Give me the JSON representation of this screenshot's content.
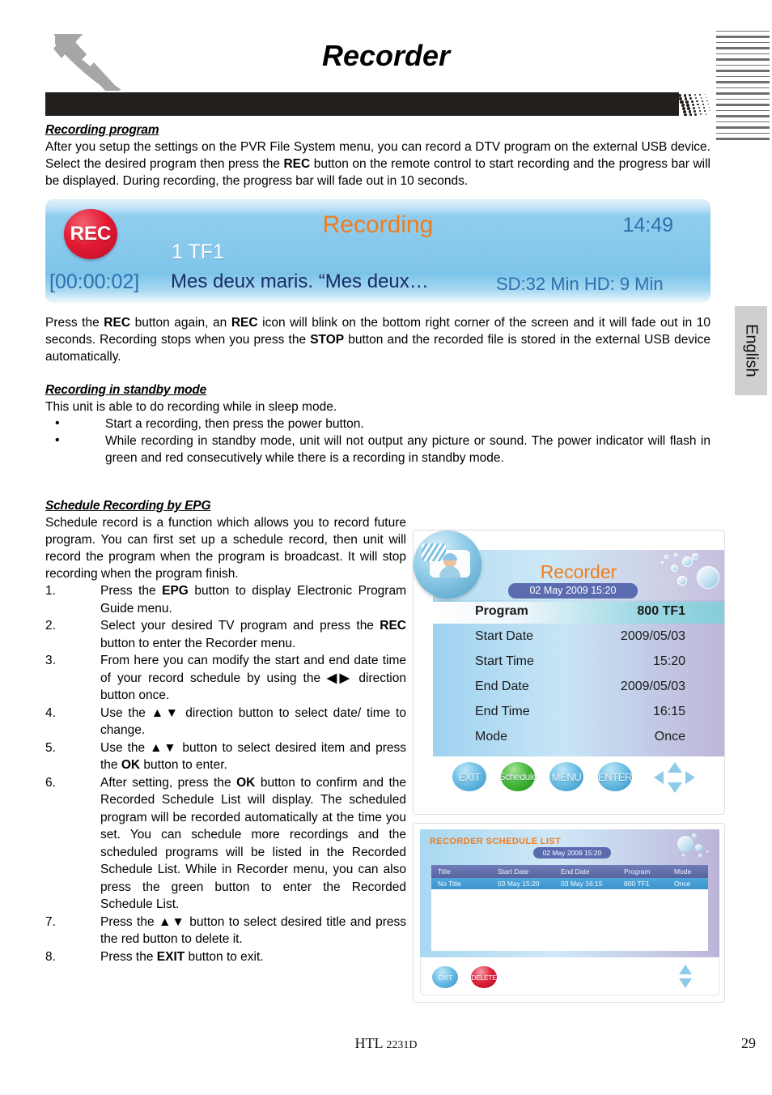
{
  "header": {
    "title": "Recorder",
    "logo": "xoro-x-logo"
  },
  "side_tab": {
    "label": "English"
  },
  "sections": {
    "recording_program": {
      "heading": "Recording program",
      "paragraph_pre": "After you setup  the settings on  the PVR File System menu, you can  record a DTV program on  the external USB device. Select  the desired program  then press  the ",
      "bold1": "REC",
      "paragraph_post": " button on  the remote control to start recording and the progress bar will be displayed. During recording, the progress bar will fade out in 10 seconds."
    },
    "after_bar": {
      "t1": "Press  the ",
      "b1": "REC",
      "t2": " button again, an ",
      "b2": "REC",
      "t3": " icon will blink on  the bottom right corner of  the screen and  it will  fade out  in 10 seconds. Recording stops when you press the ",
      "b3": "STOP",
      "t4": " button and  the recorded file is stored in the external USB device automatically."
    },
    "standby": {
      "heading": "Recording in standby mode",
      "intro": "This unit is able to do recording while in sleep mode.",
      "bullets": [
        "Start a recording, then press the power button.",
        "While recording in standby mode, unit will not output any picture or sound. The power indicator will flash in green and red consecutively while there is a recording in standby mode."
      ]
    },
    "epg": {
      "heading": "Schedule Recording by EPG",
      "intro": "Schedule  record  is a  function which allows you  to record   future  program.  You  can  first  set  up  a  schedule  record,  then unit will  record  the program when the program is broadcast. It will stop recording when the program finish.",
      "steps": [
        {
          "num": "1.",
          "pre": "Press the ",
          "bold": "EPG",
          "post": " button to display Electronic Program Guide menu."
        },
        {
          "num": "2.",
          "pre": "Select your desired TV program and press the ",
          "bold": "REC",
          "post": " button to enter the Recorder menu."
        },
        {
          "num": "3.",
          "pre": "From here you can modify the start and end date time of your record schedule by using the ",
          "bold": "◀▶",
          "post": " direction button once."
        },
        {
          "num": "4.",
          "pre": "Use the ",
          "bold": "▲▼",
          "post": " direction button to select date/ time to change."
        },
        {
          "num": "5.",
          "pre": "Use the ▲▼ button to select desired item and press the ",
          "bold": "OK",
          "post": " button to enter."
        },
        {
          "num": "6.",
          "pre": "After setting, press the ",
          "bold": "OK",
          "post": " button to confirm and the Recorded Schedule List will display. The scheduled program will be recorded automatically at the time you set. You can schedule more recordings and the scheduled programs will be listed in the Recorded Schedule List. While in Recorder menu, you can also press the green button to enter the Recorded  Schedule List."
        },
        {
          "num": "7.",
          "pre": "Press the ▲▼ button to select desired title and press the red button to delete it.",
          "bold": "",
          "post": ""
        },
        {
          "num": "8.",
          "pre": "Press the ",
          "bold": "EXIT",
          "post": " button to exit."
        }
      ]
    }
  },
  "recording_bar": {
    "rec_badge": "REC",
    "status": "Recording",
    "clock": "14:49",
    "channel": "1 TF1",
    "elapsed": "[00:00:02]",
    "program": "Mes deux maris. “Mes deux…",
    "capacity": "SD:32 Min  HD: 9 Min",
    "accent_orange": "#ef7d1f",
    "accent_blue": "#2f6fae",
    "rec_red": "#e31b35"
  },
  "recorder_menu": {
    "icon": "recorder-tv-icon",
    "title": "Recorder",
    "datetime": "02 May 2009 15:20",
    "rows": [
      {
        "label": "Program",
        "value": "800 TF1",
        "selected": true
      },
      {
        "label": "Start Date",
        "value": "2009/05/03",
        "selected": false
      },
      {
        "label": "Start Time",
        "value": "15:20",
        "selected": false
      },
      {
        "label": "End Date",
        "value": "2009/05/03",
        "selected": false
      },
      {
        "label": "End Time",
        "value": "16:15",
        "selected": false
      },
      {
        "label": "Mode",
        "value": "Once",
        "selected": false
      }
    ],
    "buttons": [
      {
        "label": "EXIT",
        "color": "blue"
      },
      {
        "label": "Schedule",
        "color": "green"
      },
      {
        "label": "MENU",
        "color": "blue"
      },
      {
        "label": "ENTER",
        "color": "blue"
      }
    ],
    "dpad": "direction-pad-icon"
  },
  "schedule_list": {
    "title": "RECORDER SCHEDULE LIST",
    "datetime": "02 May 2009 15:20",
    "columns": [
      "Title",
      "Start Date",
      "End Date",
      "Program",
      "Mode"
    ],
    "rows": [
      [
        "No Title",
        "03 May 15:20",
        "03 May 16:15",
        "800  TF1",
        "Once"
      ]
    ],
    "buttons": [
      {
        "label": "EXIT",
        "color": "blue"
      },
      {
        "label": "DELETE",
        "color": "red"
      }
    ],
    "updown": "up-down-arrows-icon"
  },
  "footer": {
    "model_prefix": "HTL ",
    "model_suffix": "2231D",
    "page_number": "29"
  }
}
